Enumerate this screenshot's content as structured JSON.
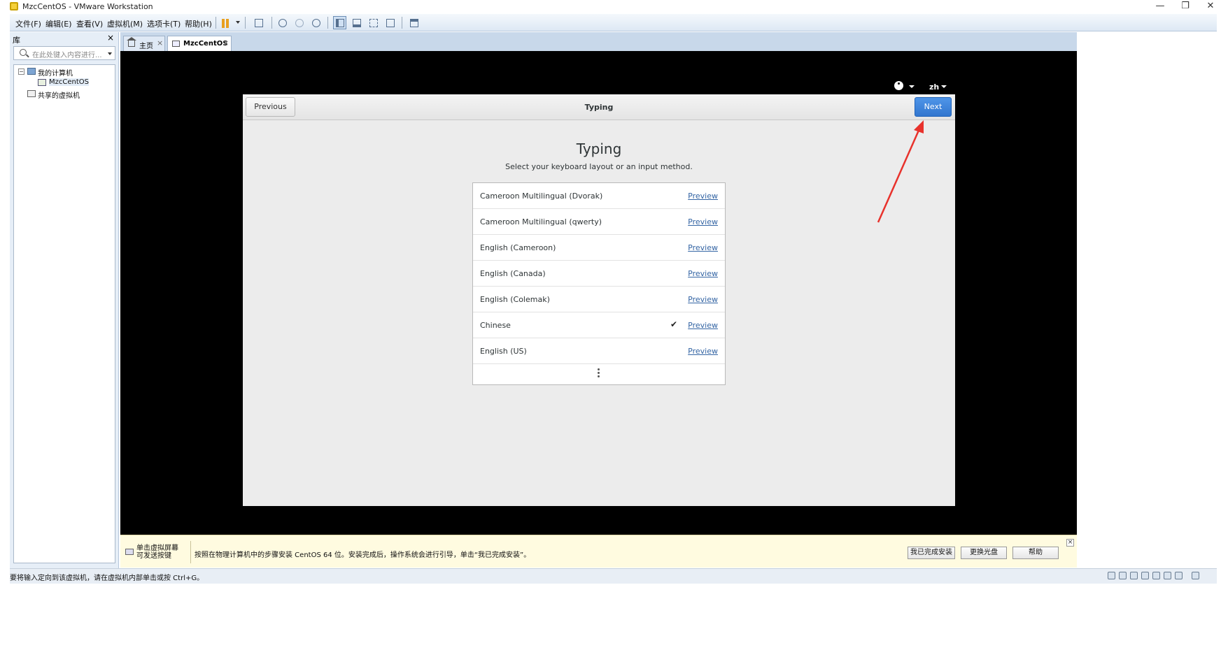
{
  "window": {
    "title": "MzcCentOS - VMware Workstation",
    "minimize": "—",
    "restore": "❐",
    "close": "✕"
  },
  "menu": {
    "items": [
      "文件(F)",
      "编辑(E)",
      "查看(V)",
      "虚拟机(M)",
      "选项卡(T)",
      "帮助(H)"
    ]
  },
  "library": {
    "title": "库",
    "close": "×",
    "search_placeholder": "在此处键入内容进行...",
    "tree": {
      "root_label": "我的计算机",
      "toggle": "−",
      "vm_label": "MzcCentOS",
      "shared_label": "共享的虚拟机"
    }
  },
  "tabs": [
    {
      "label": "主页",
      "close": "×"
    },
    {
      "label": "MzcCentOS",
      "close": "×"
    }
  ],
  "vm": {
    "language_code": "zh",
    "installer": {
      "prev_label": "Previous",
      "header_title": "Typing",
      "next_label": "Next",
      "heading": "Typing",
      "subtitle": "Select your keyboard layout or an input method.",
      "preview_label": "Preview",
      "layouts": [
        {
          "name": "Cameroon Multilingual (Dvorak)",
          "selected": false
        },
        {
          "name": "Cameroon Multilingual (qwerty)",
          "selected": false
        },
        {
          "name": "English (Cameroon)",
          "selected": false
        },
        {
          "name": "English (Canada)",
          "selected": false
        },
        {
          "name": "English (Colemak)",
          "selected": false
        },
        {
          "name": "Chinese",
          "selected": true
        },
        {
          "name": "English (US)",
          "selected": false
        }
      ],
      "check_mark": "✔"
    }
  },
  "hint": {
    "left_line1": "单击虚拟屏幕",
    "left_line2": "可发送按键",
    "message": "按照在物理计算机中的步骤安装 CentOS 64 位。安装完成后，操作系统会进行引导，单击“我已完成安装”。",
    "btn_done": "我已完成安装",
    "btn_change_disc": "更换光盘",
    "btn_help": "帮助",
    "close": "×"
  },
  "status": {
    "text": "要将输入定向到该虚拟机，请在虚拟机内部单击或按 Ctrl+G。"
  },
  "colors": {
    "next_button": "#3a7fd8",
    "annotation_arrow": "#e8322c",
    "link": "#3465a4"
  }
}
